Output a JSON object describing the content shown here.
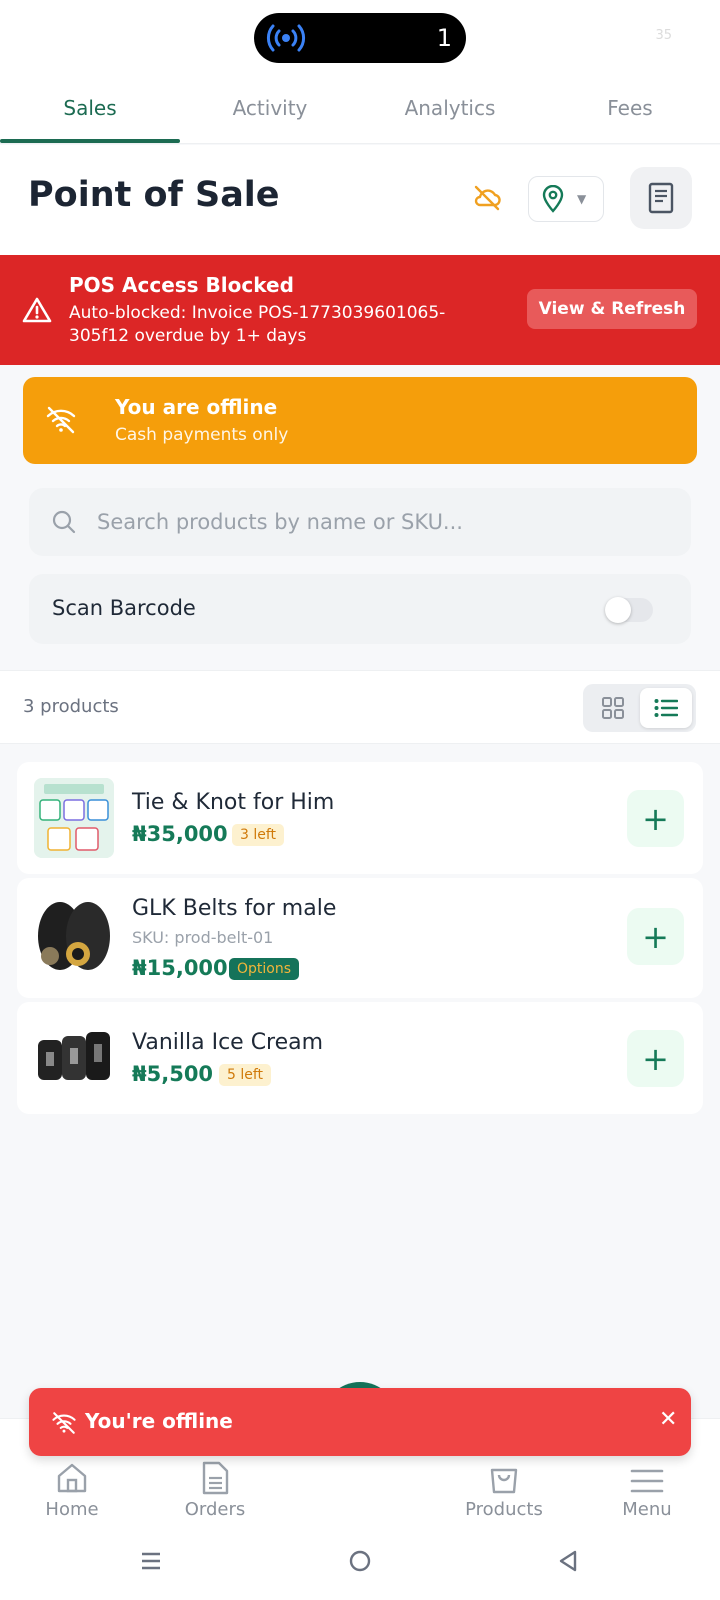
{
  "status_bar": {
    "island_count": "1",
    "right_text": "35"
  },
  "tabs": [
    {
      "label": "Sales",
      "active": true
    },
    {
      "label": "Activity",
      "active": false
    },
    {
      "label": "Analytics",
      "active": false
    },
    {
      "label": "Fees",
      "active": false
    }
  ],
  "header": {
    "title": "Point of Sale",
    "icons": [
      "cloud-off-icon",
      "location-pin-icon",
      "receipt-icon"
    ]
  },
  "alert": {
    "title": "POS Access Blocked",
    "message": "Auto-blocked: Invoice POS-1773039601065-305f12 overdue by 1+ days",
    "button": "View & Refresh",
    "color": "#dc2626"
  },
  "offline_banner": {
    "title": "You are offline",
    "subtitle": "Cash payments only",
    "color": "#f59e0b"
  },
  "search": {
    "placeholder": "Search products by name or SKU..."
  },
  "scan": {
    "label": "Scan Barcode",
    "enabled": false
  },
  "products_bar": {
    "count_label": "3 products",
    "view_mode": "list"
  },
  "products": [
    {
      "name": "Tie & Knot for Him",
      "sku": "",
      "price": "₦35,000",
      "badge": "3 left",
      "badge_type": "stock"
    },
    {
      "name": "GLK Belts for male",
      "sku": "SKU: prod-belt-01",
      "price": "₦15,000",
      "badge": "Options",
      "badge_type": "options"
    },
    {
      "name": "Vanilla Ice Cream",
      "sku": "",
      "price": "₦5,500",
      "badge": "5 left",
      "badge_type": "stock"
    }
  ],
  "toast": {
    "message": "You're offline",
    "close": "✕"
  },
  "bottom_nav": [
    {
      "label": "Home",
      "icon": "home-icon"
    },
    {
      "label": "Orders",
      "icon": "document-icon"
    },
    {
      "label": "Products",
      "icon": "shopping-bag-icon"
    },
    {
      "label": "Menu",
      "icon": "hamburger-menu-icon"
    }
  ],
  "theme": {
    "primary": "#157a58",
    "danger": "#ef4444",
    "warning": "#f59e0b"
  }
}
